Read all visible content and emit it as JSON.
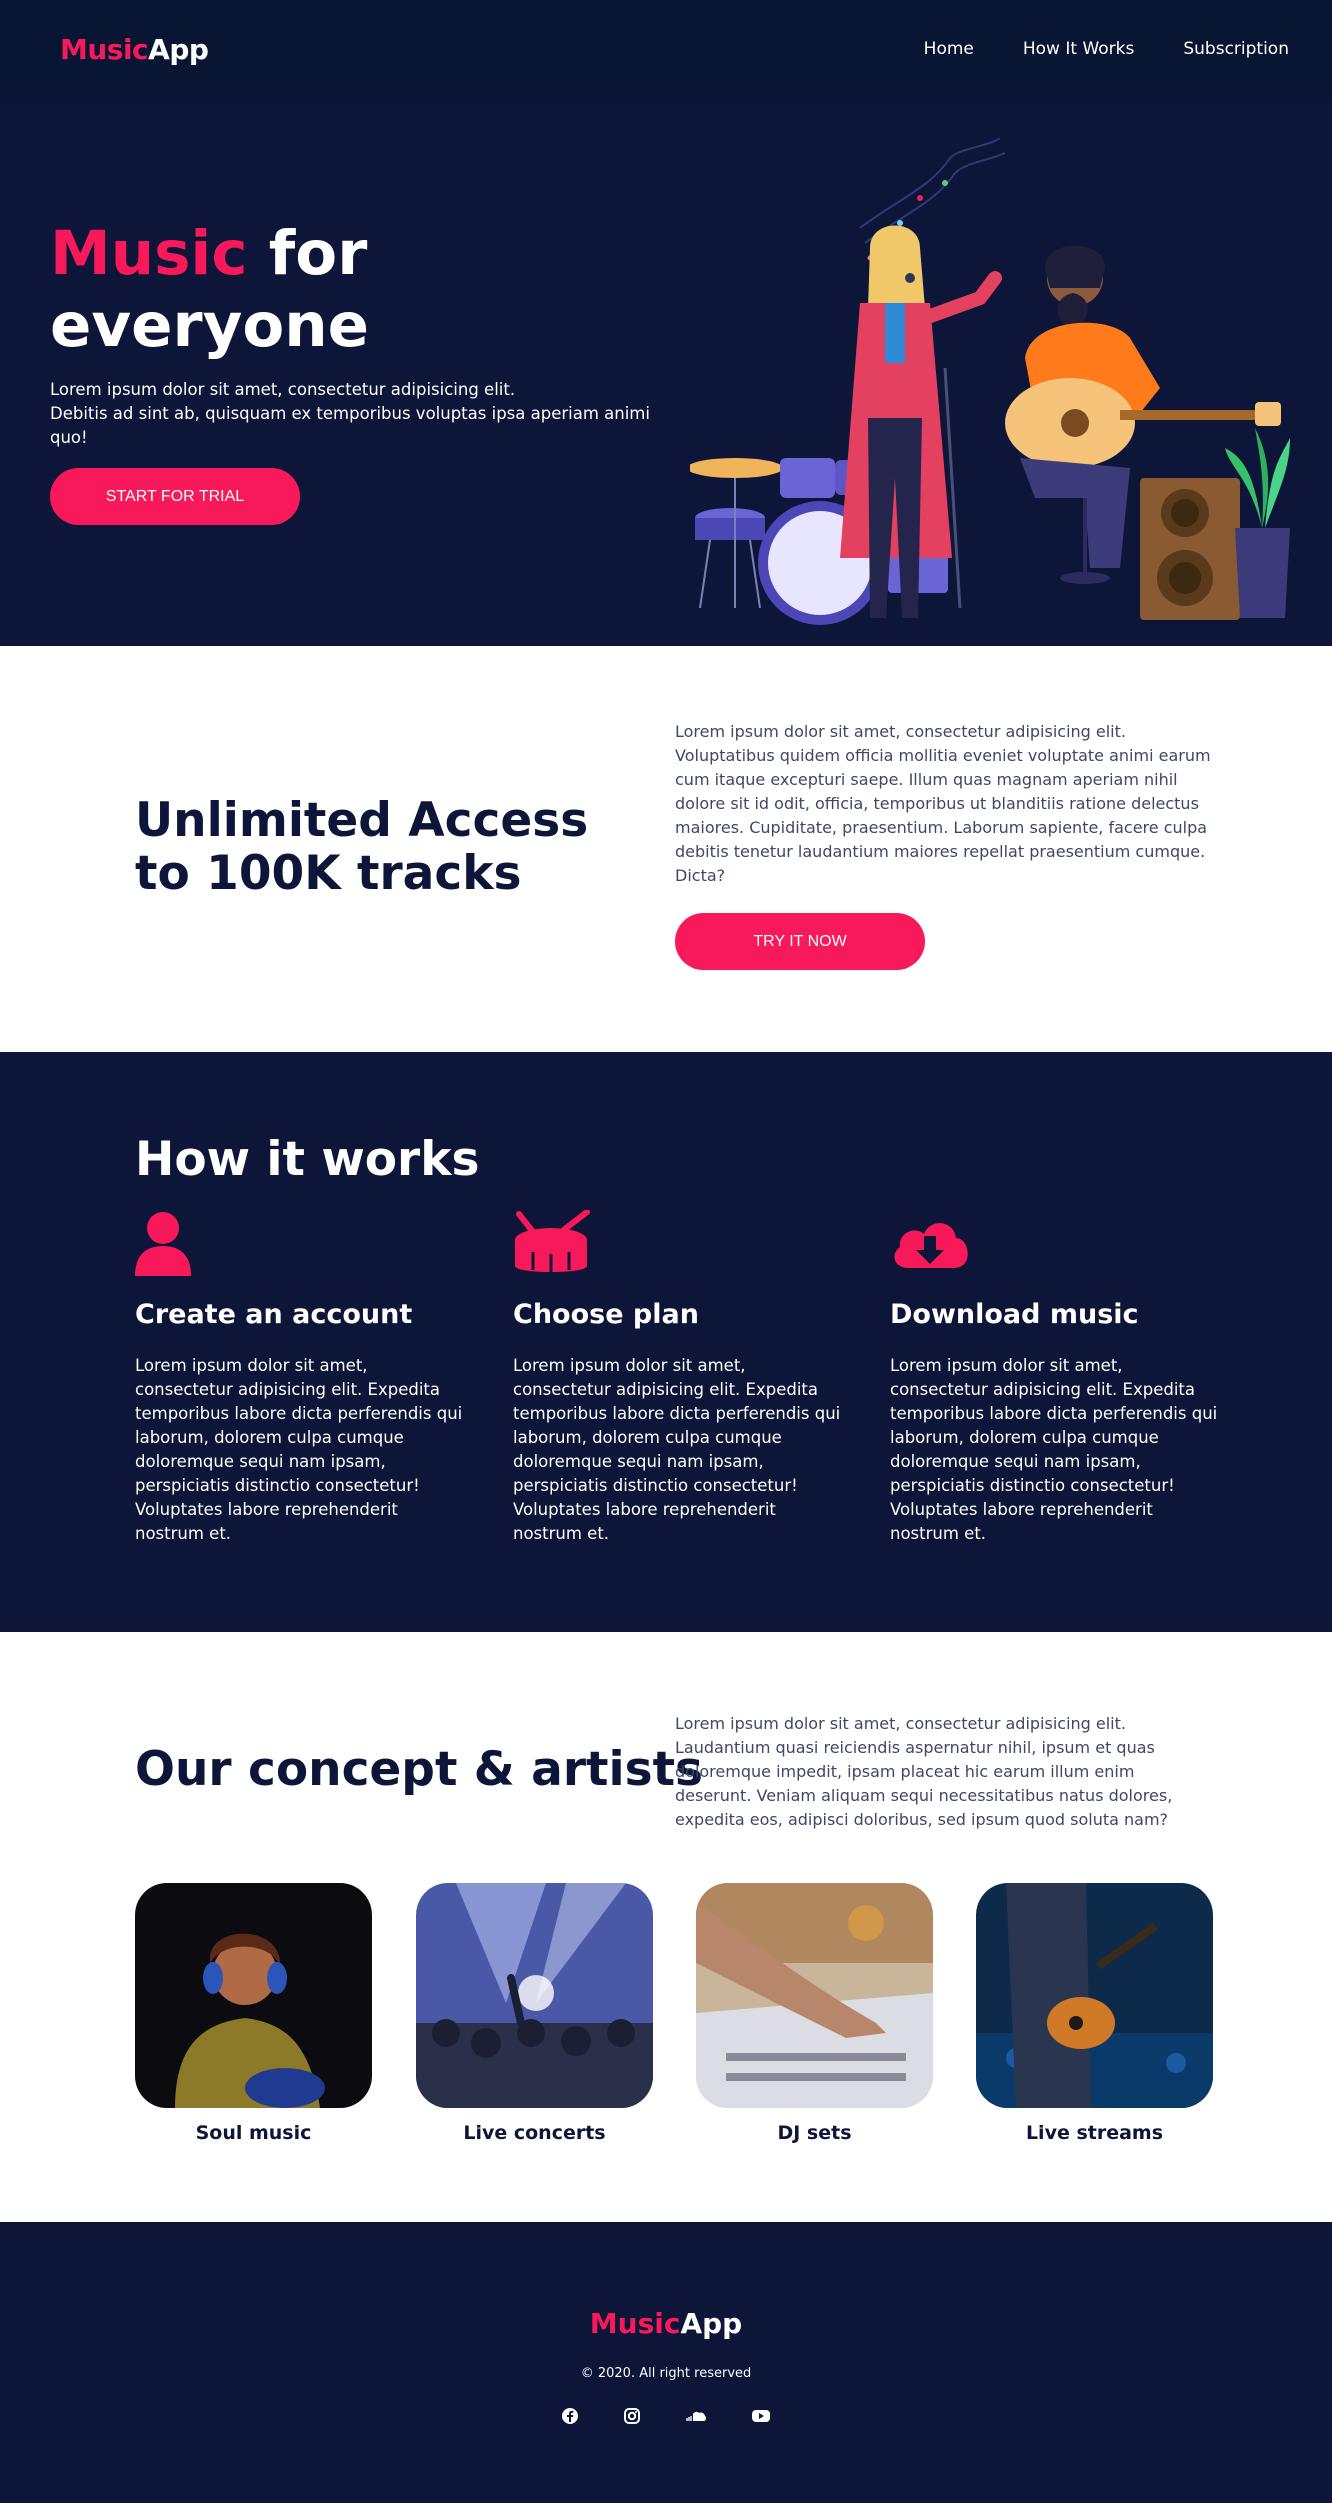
{
  "nav": {
    "logo_accent": "Music",
    "logo_rest": "App",
    "links": [
      "Home",
      "How It Works",
      "Subscription"
    ]
  },
  "hero": {
    "title_accent": "Music",
    "title_rest_1": " for",
    "title_rest_2": "everyone",
    "subtitle_line1": "Lorem ipsum dolor sit amet, consectetur adipisicing elit.",
    "subtitle_line2": "Debitis ad sint ab, quisquam ex temporibus voluptas ipsa aperiam animi quo!",
    "cta": "START FOR TRIAL"
  },
  "access": {
    "title": "Unlimited Access to 100K tracks",
    "text": "Lorem ipsum dolor sit amet, consectetur adipisicing elit. Voluptatibus quidem officia mollitia eveniet voluptate animi earum cum itaque excepturi saepe. Illum quas magnam aperiam nihil dolore sit id odit, officia, temporibus ut blanditiis ratione delectus maiores. Cupiditate, praesentium. Laborum sapiente, facere culpa debitis tenetur laudantium maiores repellat praesentium cumque. Dicta?",
    "cta": "TRY IT NOW"
  },
  "how": {
    "title": "How it works",
    "steps": [
      {
        "icon": "user-icon",
        "title": "Create an account",
        "text": "Lorem ipsum dolor sit amet, consectetur adipisicing elit. Expedita temporibus labore dicta perferendis qui laborum, dolorem culpa cumque doloremque sequi nam ipsam, perspiciatis distinctio consectetur! Voluptates labore reprehenderit nostrum et."
      },
      {
        "icon": "drum-icon",
        "title": "Choose plan",
        "text": "Lorem ipsum dolor sit amet, consectetur adipisicing elit. Expedita temporibus labore dicta perferendis qui laborum, dolorem culpa cumque doloremque sequi nam ipsam, perspiciatis distinctio consectetur! Voluptates labore reprehenderit nostrum et."
      },
      {
        "icon": "cloud-download-icon",
        "title": "Download music",
        "text": "Lorem ipsum dolor sit amet, consectetur adipisicing elit. Expedita temporibus labore dicta perferendis qui laborum, dolorem culpa cumque doloremque sequi nam ipsam, perspiciatis distinctio consectetur! Voluptates labore reprehenderit nostrum et."
      }
    ]
  },
  "concept": {
    "title": "Our concept & artists",
    "text": "Lorem ipsum dolor sit amet, consectetur adipisicing elit. Laudantium quasi reiciendis aspernatur nihil, ipsum et quas doloremque impedit, ipsam placeat hic earum illum enim deserunt. Veniam aliquam sequi necessitatibus natus dolores, expedita eos, adipisci doloribus, sed ipsum quod soluta nam?",
    "cards": [
      {
        "label": "Soul music"
      },
      {
        "label": "Live concerts"
      },
      {
        "label": "DJ sets"
      },
      {
        "label": "Live streams"
      }
    ]
  },
  "footer": {
    "logo_accent": "Music",
    "logo_rest": "App",
    "copyright": "© 2020. All right reserved",
    "socials": [
      "facebook-icon",
      "instagram-icon",
      "soundcloud-icon",
      "youtube-icon"
    ]
  },
  "colors": {
    "accent": "#f7195a",
    "navy": "#0d1539",
    "nav_bg": "#091633"
  }
}
